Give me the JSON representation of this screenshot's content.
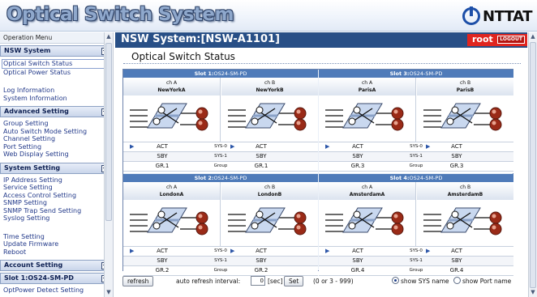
{
  "banner": {
    "title": "Optical Switch System",
    "logo_text": "NTTAT"
  },
  "sidebar": {
    "header": "Operation Menu",
    "sections": [
      {
        "label": "NSW System",
        "toggle": "−",
        "items": [
          [
            "Optical Switch Status",
            "Optical Power Status"
          ],
          [
            "Log Information",
            "System Information"
          ]
        ]
      },
      {
        "label": "Advanced Setting",
        "toggle": "−",
        "items": [
          [
            "Group Setting",
            "Auto Switch Mode Setting",
            "Channel Setting",
            "Port Setting",
            "Web Display Setting"
          ]
        ]
      },
      {
        "label": "System Setting",
        "toggle": "−",
        "items": [
          [
            "IP Address Setting",
            "Service Setting",
            "Access Control Setting",
            "SNMP Setting",
            "SNMP Trap Send Setting",
            "Syslog Setting"
          ],
          [
            "Time Setting",
            "Update Firmware",
            "Reboot"
          ]
        ]
      },
      {
        "label": "Account Setting",
        "toggle": "+",
        "items": []
      },
      {
        "label": "Slot 1:OS24-SM-PD",
        "toggle": "−",
        "items": [
          [
            "OptPower Detect Setting"
          ]
        ]
      }
    ],
    "selected_item": "Optical Switch Status"
  },
  "main": {
    "header_title": "NSW System:[NSW-A1101]",
    "user": "root",
    "logout_label": "LOGOUT",
    "page_title": "Optical Switch Status"
  },
  "slots": [
    {
      "slot_label": "Slot 1:",
      "slot_model": "OS24-SM-PD",
      "ch_a_label": "ch A",
      "ch_a_name": "NewYorkA",
      "ch_b_label": "ch B",
      "ch_b_name": "NewYorkB",
      "rows": [
        [
          "ACT",
          "SYS-0",
          "ACT"
        ],
        [
          "SBY",
          "SYS-1",
          "SBY"
        ],
        [
          "GR.1",
          "Group",
          "GR.1"
        ]
      ]
    },
    {
      "slot_label": "Slot 3:",
      "slot_model": "OS24-SM-PD",
      "ch_a_label": "ch A",
      "ch_a_name": "ParisA",
      "ch_b_label": "ch B",
      "ch_b_name": "ParisB",
      "rows": [
        [
          "ACT",
          "SYS-0",
          "ACT"
        ],
        [
          "SBY",
          "SYS-1",
          "SBY"
        ],
        [
          "GR.3",
          "Group",
          "GR.3"
        ]
      ]
    },
    {
      "slot_label": "Slot 2:",
      "slot_model": "OS24-SM-PD",
      "ch_a_label": "ch A",
      "ch_a_name": "LondonA",
      "ch_b_label": "ch B",
      "ch_b_name": "LondonB",
      "rows": [
        [
          "ACT",
          "SYS-0",
          "ACT"
        ],
        [
          "SBY",
          "SYS-1",
          "SBY"
        ],
        [
          "GR.2",
          "Group",
          "GR.2"
        ]
      ]
    },
    {
      "slot_label": "Slot 4:",
      "slot_model": "OS24-SM-PD",
      "ch_a_label": "ch A",
      "ch_a_name": "AmsterdamA",
      "ch_b_label": "ch B",
      "ch_b_name": "AmsterdamB",
      "rows": [
        [
          "ACT",
          "SYS-0",
          "ACT"
        ],
        [
          "SBY",
          "SYS-1",
          "SBY"
        ],
        [
          "GR.4",
          "Group",
          "GR.4"
        ]
      ]
    }
  ],
  "controls": {
    "refresh_label": "refresh",
    "auto_refresh_label": "auto refresh interval:",
    "interval_value": "0",
    "unit_label": "[sec]",
    "set_label": "Set",
    "range_label": "(0 or 3 - 999)",
    "opt_sys": "show SYS name",
    "opt_port": "show Port name"
  },
  "colors": {
    "header_blue": "#284f86",
    "slot_header": "#4f7bb9",
    "user_red": "#e0251f"
  }
}
